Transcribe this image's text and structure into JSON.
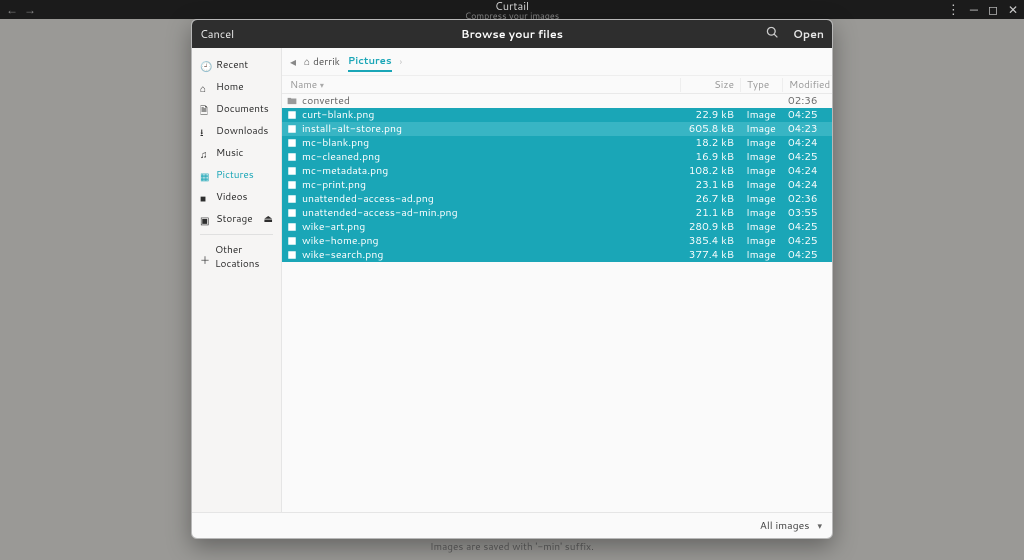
{
  "app": {
    "title": "Curtail",
    "subtitle": "Compress your images",
    "hint": "Images are saved with '-min' suffix."
  },
  "dialog": {
    "cancel": "Cancel",
    "title": "Browse your files",
    "open": "Open",
    "filter": "All images"
  },
  "pathbar": {
    "crumb1": "derrik",
    "crumb2": "Pictures"
  },
  "columns": {
    "name": "Name",
    "size": "Size",
    "type": "Type",
    "modified": "Modified"
  },
  "sidebar": {
    "recent": "Recent",
    "home": "Home",
    "documents": "Documents",
    "downloads": "Downloads",
    "music": "Music",
    "pictures": "Pictures",
    "videos": "Videos",
    "storage": "Storage",
    "other": "Other Locations"
  },
  "rows": [
    {
      "name": "converted",
      "size": "",
      "type": "",
      "mod": "02:36",
      "kind": "folder",
      "sel": false
    },
    {
      "name": "curt-blank.png",
      "size": "22.9 kB",
      "type": "Image",
      "mod": "04:25",
      "kind": "img",
      "sel": true
    },
    {
      "name": "install-alt-store.png",
      "size": "605.8 kB",
      "type": "Image",
      "mod": "04:23",
      "kind": "img",
      "sel": true,
      "alt": true
    },
    {
      "name": "mc-blank.png",
      "size": "18.2 kB",
      "type": "Image",
      "mod": "04:24",
      "kind": "img",
      "sel": true
    },
    {
      "name": "mc-cleaned.png",
      "size": "16.9 kB",
      "type": "Image",
      "mod": "04:25",
      "kind": "img",
      "sel": true
    },
    {
      "name": "mc-metadata.png",
      "size": "108.2 kB",
      "type": "Image",
      "mod": "04:24",
      "kind": "img",
      "sel": true
    },
    {
      "name": "mc-print.png",
      "size": "23.1 kB",
      "type": "Image",
      "mod": "04:24",
      "kind": "img",
      "sel": true
    },
    {
      "name": "unattended-access-ad.png",
      "size": "26.7 kB",
      "type": "Image",
      "mod": "02:36",
      "kind": "img",
      "sel": true
    },
    {
      "name": "unattended-access-ad-min.png",
      "size": "21.1 kB",
      "type": "Image",
      "mod": "03:55",
      "kind": "img",
      "sel": true
    },
    {
      "name": "wike-art.png",
      "size": "280.9 kB",
      "type": "Image",
      "mod": "04:25",
      "kind": "img",
      "sel": true
    },
    {
      "name": "wike-home.png",
      "size": "385.4 kB",
      "type": "Image",
      "mod": "04:25",
      "kind": "img",
      "sel": true
    },
    {
      "name": "wike-search.png",
      "size": "377.4 kB",
      "type": "Image",
      "mod": "04:25",
      "kind": "img",
      "sel": true
    }
  ]
}
